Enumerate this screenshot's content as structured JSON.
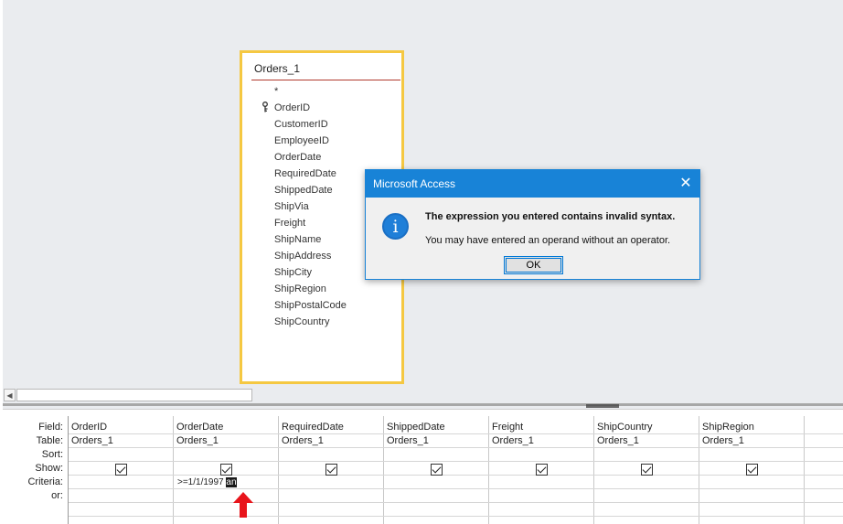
{
  "field_list": {
    "title": "Orders_1",
    "fields": [
      "*",
      "OrderID",
      "CustomerID",
      "EmployeeID",
      "OrderDate",
      "RequiredDate",
      "ShippedDate",
      "ShipVia",
      "Freight",
      "ShipName",
      "ShipAddress",
      "ShipCity",
      "ShipRegion",
      "ShipPostalCode",
      "ShipCountry"
    ]
  },
  "dialog": {
    "title": "Microsoft Access",
    "close_glyph": "✕",
    "icon_glyph": "i",
    "message_main": "The expression you entered contains invalid syntax.",
    "message_sub": "You may have entered an operand without an operator.",
    "ok_label": "OK"
  },
  "grid": {
    "row_labels": {
      "field": "Field:",
      "table": "Table:",
      "sort": "Sort:",
      "show": "Show:",
      "criteria": "Criteria:",
      "or": "or:"
    },
    "columns": [
      {
        "field": "OrderID",
        "table": "Orders_1",
        "show": true
      },
      {
        "field": "OrderDate",
        "table": "Orders_1",
        "show": true
      },
      {
        "field": "RequiredDate",
        "table": "Orders_1",
        "show": true
      },
      {
        "field": "ShippedDate",
        "table": "Orders_1",
        "show": true
      },
      {
        "field": "Freight",
        "table": "Orders_1",
        "show": true
      },
      {
        "field": "ShipCountry",
        "table": "Orders_1",
        "show": true
      },
      {
        "field": "ShipRegion",
        "table": "Orders_1",
        "show": true
      }
    ],
    "criteria_value": ">=1/1/1997 ",
    "criteria_selected": "an"
  },
  "scroll_glyph": "◀",
  "colors": {
    "dialog_titlebar": "#1883d7",
    "field_list_border": "#f5c842",
    "annotation_arrow": "#e8141b"
  },
  "icons": [
    "key-icon",
    "info-icon",
    "close-icon",
    "checkbox",
    "annotation-arrow"
  ]
}
